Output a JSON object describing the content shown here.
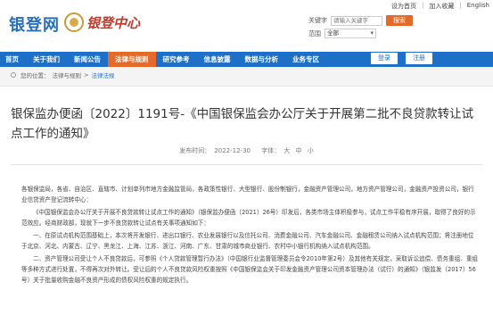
{
  "header": {
    "logo_text": "银登网",
    "center_text": "银登中心",
    "top_links": [
      "设为首页",
      "加入收藏",
      "English"
    ],
    "search_label": "关键字",
    "search_placeholder": "请输入关键字",
    "search_button": "搜索",
    "scope_label": "范围",
    "scope_value": "全部"
  },
  "nav": {
    "items": [
      "首页",
      "关于我们",
      "新闻公告",
      "法律与规则",
      "研究参考",
      "信息披露",
      "数据与分析",
      "业务专区"
    ],
    "active_index": 3,
    "login": "登录",
    "register": "注册"
  },
  "breadcrumb": {
    "prefix": "您的位置：",
    "items": [
      "法律与规则",
      "法律法规"
    ]
  },
  "article": {
    "title": "银保监办便函〔2022〕1191号-《中国银保监会办公厅关于开展第二批不良贷款转让试点工作的通知》",
    "publish_label": "发布时间：",
    "publish_date": "2022-12-30",
    "font_label": "字体：",
    "font_sizes": [
      "大",
      "中",
      "小"
    ],
    "paragraphs": [
      "各银保监局，各省、自治区、直辖市、计划单列市地方金融监管局，各政策性银行、大型银行、股份制银行，金融资产管理公司，地方资产管理公司，金融资产投资公司，银行业信贷资产登记流转中心：",
      "《中国银保监会办公厅关于开展不良贷款转让试点工作的通知》（银保监办便函〔2021〕26号）印发后，各类市场主体积极参与，试点工作平稳有序开展，取得了良好的示范效应。经商财政部，现就下一步不良贷款转让试点有关事项通知如下：",
      "一、在原试点机构范围基础上，本次将开发银行、进出口银行、农业发展银行以及信托公司、消费金融公司、汽车金融公司、金融租赁公司纳入试点机构范围；将注册地位于北京、河北、内蒙古、辽宁、黑龙江、上海、江苏、浙江、河南、广东、甘肃的城市商业银行、农村中小银行机构纳入试点机构范围。",
      "二、资产管理公司受让个人不良贷款后，可参照《个人贷款管理暂行办法》（中国银行业监督管理委员会令2010年第2号）及其他有关规定，采取诉讼追偿、债务重组、重组等多种方式进行处置，不得再次对外转让。受让后的个人不良贷款风险权重按照《中国银保监会关于印发金融资产管理公司资本管理办法（试行）的通知》（银监发〔2017〕56号）关于批量收购金融不良资产形成的债权风险权重的规定执行。"
    ]
  }
}
